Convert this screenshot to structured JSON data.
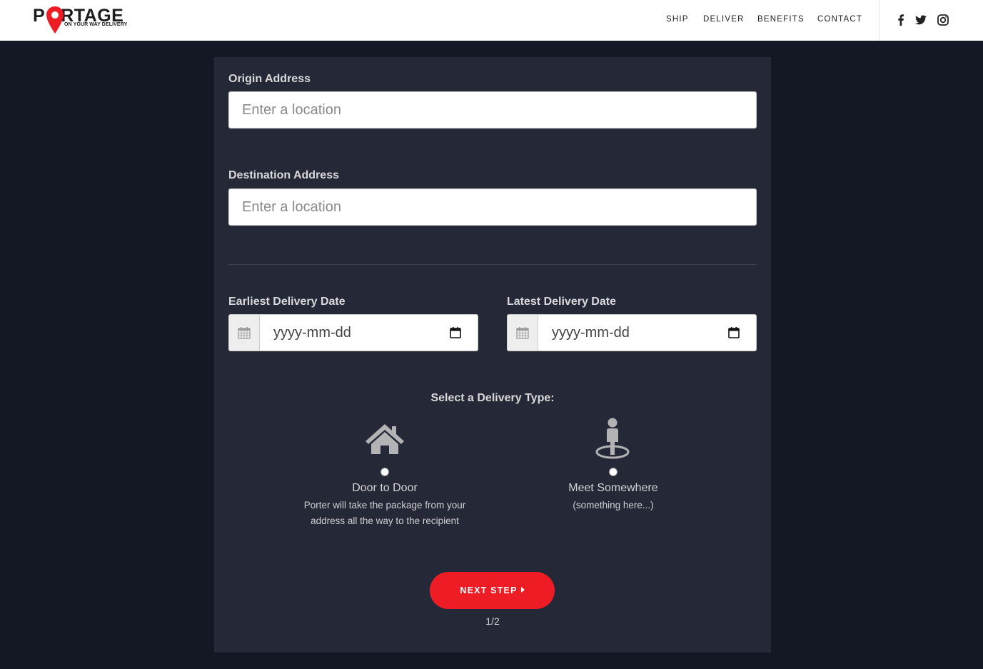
{
  "brand": {
    "name": "PORTAGE",
    "tagline": "ON YOUR WAY DELIVERY",
    "accent_color": "#ee1c25"
  },
  "nav": {
    "links": [
      "SHIP",
      "DELIVER",
      "BENEFITS",
      "CONTACT"
    ],
    "social_icons": [
      "facebook-icon",
      "twitter-icon",
      "instagram-icon"
    ]
  },
  "form": {
    "origin": {
      "label": "Origin Address",
      "placeholder": "Enter a location"
    },
    "destination": {
      "label": "Destination Address",
      "placeholder": "Enter a location"
    },
    "earliest_date": {
      "label": "Earliest Delivery Date",
      "value": "yyyy-mm-dd"
    },
    "latest_date": {
      "label": "Latest Delivery Date",
      "value": "yyyy-mm-dd"
    },
    "delivery_type": {
      "title": "Select a Delivery Type:",
      "options": [
        {
          "icon": "house-icon",
          "name": "Door to Door",
          "description_lines": [
            "Porter will take the package from your",
            "address all the way to the recipient"
          ]
        },
        {
          "icon": "person-pin-icon",
          "name": "Meet Somewhere",
          "description_lines": [
            "(something here...)"
          ]
        }
      ]
    },
    "next_button": "NEXT STEP",
    "step_indicator": "1/2"
  }
}
